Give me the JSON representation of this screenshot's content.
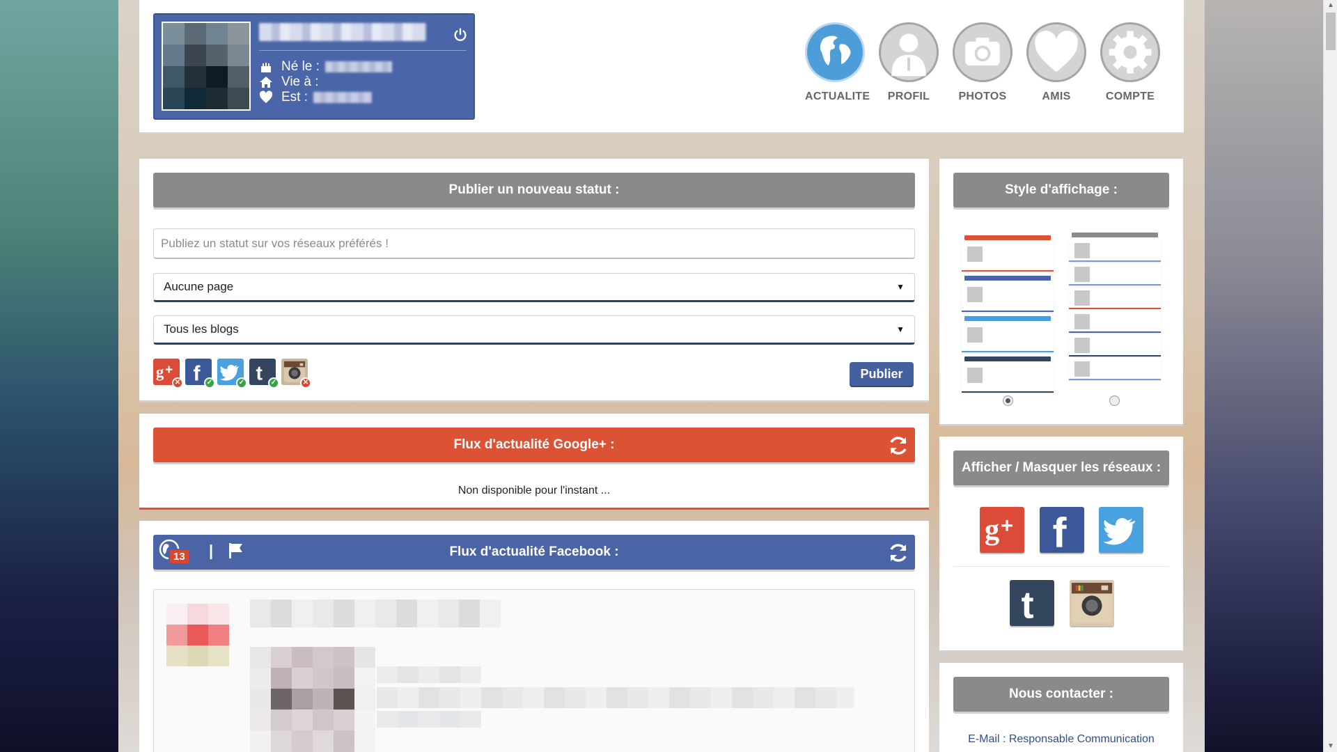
{
  "profile": {
    "born_label": "Né le :",
    "lives_label": "Vie à :",
    "status_label": "Est :"
  },
  "nav": [
    {
      "label": "ACTUALITE",
      "icon": "globe-icon",
      "active": true
    },
    {
      "label": "PROFIL",
      "icon": "user-icon",
      "active": false
    },
    {
      "label": "PHOTOS",
      "icon": "camera-icon",
      "active": false
    },
    {
      "label": "AMIS",
      "icon": "heart-icon",
      "active": false
    },
    {
      "label": "COMPTE",
      "icon": "gear-icon",
      "active": false
    }
  ],
  "publish": {
    "title": "Publier un nouveau statut :",
    "placeholder": "Publiez un statut sur vos réseaux préférés !",
    "page_select": "Aucune page",
    "blog_select": "Tous les blogs",
    "networks": [
      {
        "name": "Google+",
        "icon": "google-plus-icon",
        "color": "#dc4a38",
        "enabled": false
      },
      {
        "name": "Facebook",
        "icon": "facebook-icon",
        "color": "#3b5998",
        "enabled": true
      },
      {
        "name": "Twitter",
        "icon": "twitter-icon",
        "color": "#4aa1e0",
        "enabled": true
      },
      {
        "name": "Tumblr",
        "icon": "tumblr-icon",
        "color": "#34465d",
        "enabled": true
      },
      {
        "name": "Instagram",
        "icon": "instagram-icon",
        "color": "#b8a48a",
        "enabled": false
      }
    ],
    "button": "Publier"
  },
  "gplus_feed": {
    "title": "Flux d'actualité Google+ :",
    "message": "Non disponible pour l'instant ...",
    "color": "#dc5235"
  },
  "fb_feed": {
    "title": "Flux d'actualité Facebook :",
    "separator": "|",
    "notification_count": "13",
    "color": "#4a64a5"
  },
  "style_panel": {
    "title": "Style d'affichage :",
    "left_bar_colors": [
      "#dc5235",
      "#4a64a5",
      "#4d9ed8",
      "#34465d"
    ],
    "selected": 0
  },
  "networks_panel": {
    "title": "Afficher / Masquer les réseaux :"
  },
  "contact": {
    "title": "Nous contacter :",
    "email": "E-Mail : Responsable Communication"
  }
}
